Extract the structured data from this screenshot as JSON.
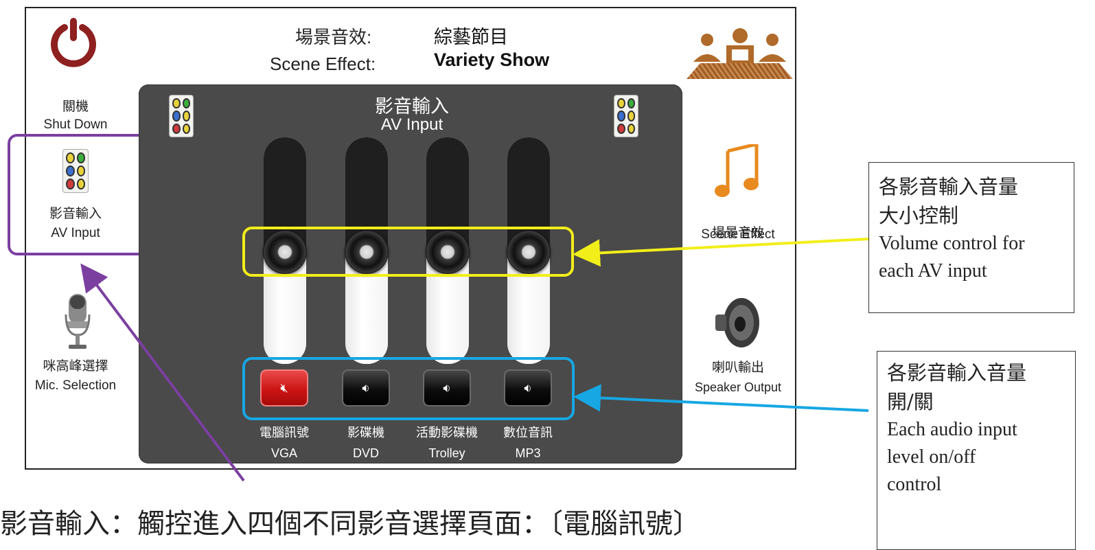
{
  "header": {
    "scene_label_zh": "場景音效:",
    "scene_label_en": "Scene Effect:",
    "scene_value_zh": "綜藝節目",
    "scene_value_en": "Variety Show"
  },
  "left_nav": [
    {
      "zh": "關機",
      "en": "Shut Down",
      "icon": "power-icon"
    },
    {
      "zh": "影音輸入",
      "en": "AV Input",
      "icon": "av-jacks-icon"
    },
    {
      "zh": "咪高峰選擇",
      "en": "Mic. Selection",
      "icon": "microphone-icon"
    }
  ],
  "right_nav": [
    {
      "zh": "場景音效",
      "en": "Scene Effect",
      "icon": "music-note-icon"
    },
    {
      "zh": "喇叭輸出",
      "en": "Speaker Output",
      "icon": "speaker-icon"
    }
  ],
  "panel": {
    "title_zh": "影音輸入",
    "title_en": "AV Input"
  },
  "channels": [
    {
      "zh": "電腦訊號",
      "en": "VGA",
      "muted": true
    },
    {
      "zh": "影碟機",
      "en": "DVD",
      "muted": false
    },
    {
      "zh": "活動影碟機",
      "en": "Trolley",
      "muted": false
    },
    {
      "zh": "數位音訊",
      "en": "MP3",
      "muted": false
    }
  ],
  "callouts": {
    "volume": {
      "zh1": "各影音輸入音量",
      "zh2": "大小控制",
      "en1": "Volume control for",
      "en2": "each AV input"
    },
    "mute": {
      "zh1": "各影音輸入音量",
      "zh2": "開/關",
      "en1": "Each audio input",
      "en2": "level on/off",
      "en3": "control"
    }
  },
  "caption": "影音輸入：觸控進入四個不同影音選擇頁面：〔電腦訊號〕",
  "colors": {
    "panel": "#4a4a4a",
    "power": "#8e2020",
    "mute_active": "#cc1414",
    "highlight_purple": "#7b3fa0",
    "highlight_yellow": "#f2ee1a",
    "highlight_blue": "#17a7e3",
    "audience_icon": "#b06a2a"
  }
}
